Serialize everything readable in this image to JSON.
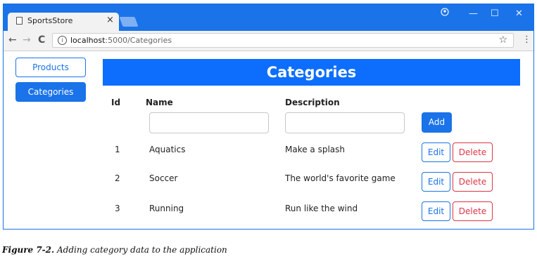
{
  "browser": {
    "tab_title": "SportsStore",
    "tab_close": "×",
    "profile_icon": "profile-icon",
    "minimize": "—",
    "maximize": "☐",
    "close": "✕",
    "back": "←",
    "forward": "→",
    "reload": "C",
    "info_icon_glyph": "i",
    "url_host": "localhost",
    "url_path": ":5000/Categories",
    "star": "☆",
    "menu": "⋮"
  },
  "sidebar": {
    "items": [
      {
        "label": "Products"
      },
      {
        "label": "Categories"
      }
    ]
  },
  "main": {
    "title": "Categories",
    "columns": {
      "id": "Id",
      "name": "Name",
      "description": "Description"
    },
    "new_row": {
      "name_value": "",
      "description_value": "",
      "add_label": "Add"
    },
    "rows": [
      {
        "id": "1",
        "name": "Aquatics",
        "description": "Make a splash",
        "edit": "Edit",
        "delete": "Delete"
      },
      {
        "id": "2",
        "name": "Soccer",
        "description": "The world's favorite game",
        "edit": "Edit",
        "delete": "Delete"
      },
      {
        "id": "3",
        "name": "Running",
        "description": "Run like the wind",
        "edit": "Edit",
        "delete": "Delete"
      }
    ]
  },
  "caption": {
    "number": "Figure 7-2.",
    "text": "Adding category data to the application"
  },
  "colors": {
    "accent": "#1a73e8",
    "banner": "#0d6efd",
    "danger": "#dc3545"
  }
}
